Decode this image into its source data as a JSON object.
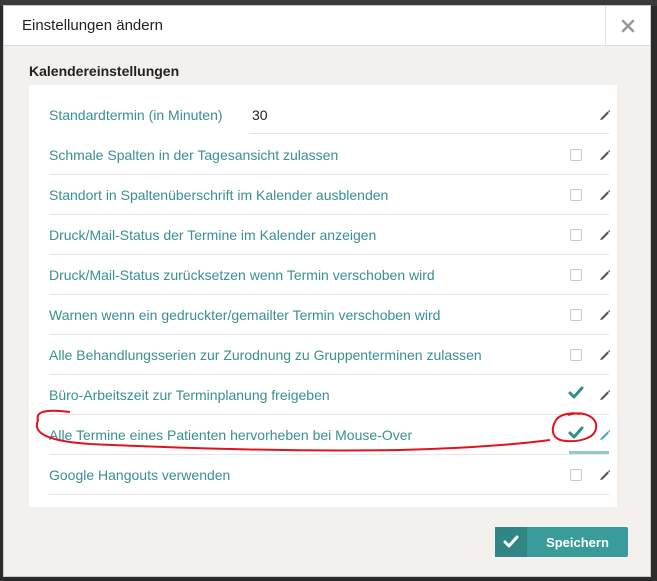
{
  "dialog": {
    "title": "Einstellungen ändern",
    "close_icon": "close-icon"
  },
  "section": {
    "title": "Kalendereinstellungen"
  },
  "settings": [
    {
      "label": "Standardtermin (in Minuten)",
      "type": "text",
      "value": "30"
    },
    {
      "label": "Schmale Spalten in der Tagesansicht zulassen",
      "type": "checkbox",
      "checked": false
    },
    {
      "label": "Standort in Spaltenüberschrift im Kalender ausblenden",
      "type": "checkbox",
      "checked": false
    },
    {
      "label": "Druck/Mail-Status der Termine im Kalender anzeigen",
      "type": "checkbox",
      "checked": false
    },
    {
      "label": "Druck/Mail-Status zurücksetzen wenn Termin verschoben wird",
      "type": "checkbox",
      "checked": false
    },
    {
      "label": "Warnen wenn ein gedruckter/gemailter Termin verschoben wird",
      "type": "checkbox",
      "checked": false
    },
    {
      "label": "Alle Behandlungsserien zur Zurodnung zu Gruppenterminen zulassen",
      "type": "checkbox",
      "checked": false
    },
    {
      "label": "Büro-Arbeitszeit zur Terminplanung freigeben",
      "type": "checkbox",
      "checked": true
    },
    {
      "label": "Alle Termine eines Patienten hervorheben bei Mouse-Over",
      "type": "checkbox",
      "checked": true,
      "active": true
    },
    {
      "label": "Google Hangouts verwenden",
      "type": "checkbox",
      "checked": false
    }
  ],
  "footer": {
    "save_label": "Speichern",
    "save_icon": "check-icon"
  },
  "colors": {
    "accent": "#3a9c9a",
    "label": "#3a8f92",
    "annotation": "#e0141e"
  }
}
